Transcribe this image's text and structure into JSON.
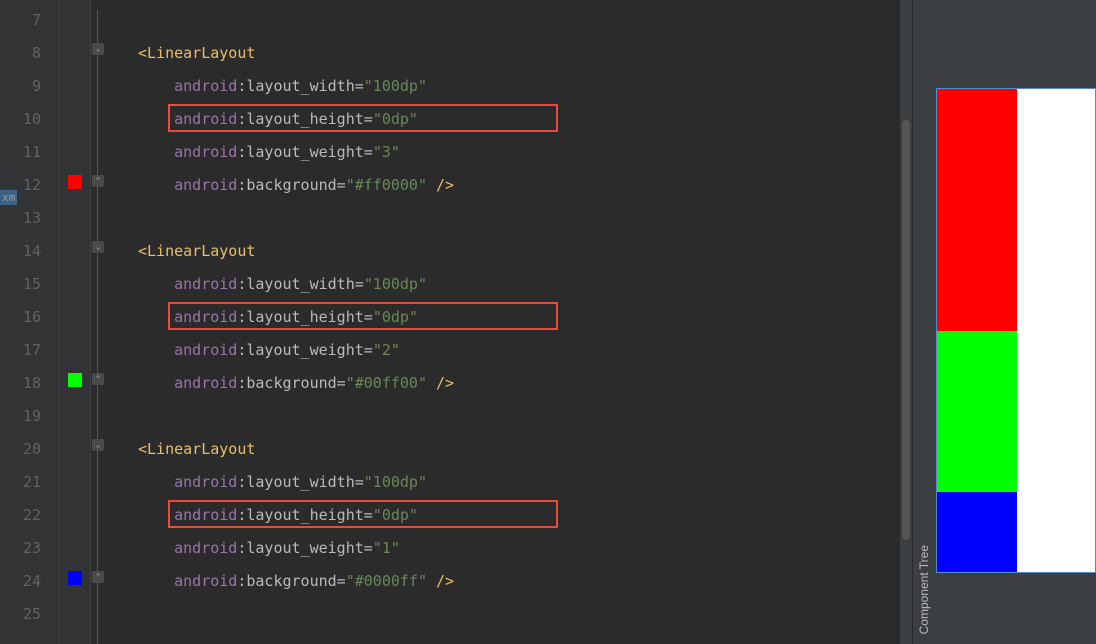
{
  "lineNumbers": [
    "7",
    "8",
    "9",
    "10",
    "11",
    "12",
    "13",
    "14",
    "15",
    "16",
    "17",
    "18",
    "19",
    "20",
    "21",
    "22",
    "23",
    "24",
    "25"
  ],
  "xmTab": "xm",
  "componentTreeLabel": "Component Tree",
  "code": {
    "l8_tag": "LinearLayout",
    "l9_ns": "android",
    "l9_attr": ":layout_width=",
    "l9_val": "\"100dp\"",
    "l10_ns": "android",
    "l10_attr": ":layout_height=",
    "l10_val": "\"0dp\"",
    "l11_ns": "android",
    "l11_attr": ":layout_weight=",
    "l11_val": "\"3\"",
    "l12_ns": "android",
    "l12_attr": ":background=",
    "l12_val": "\"#ff0000\"",
    "l12_close": " />",
    "l14_tag": "LinearLayout",
    "l15_ns": "android",
    "l15_attr": ":layout_width=",
    "l15_val": "\"100dp\"",
    "l16_ns": "android",
    "l16_attr": ":layout_height=",
    "l16_val": "\"0dp\"",
    "l17_ns": "android",
    "l17_attr": ":layout_weight=",
    "l17_val": "\"2\"",
    "l18_ns": "android",
    "l18_attr": ":background=",
    "l18_val": "\"#00ff00\"",
    "l18_close": " />",
    "l20_tag": "LinearLayout",
    "l21_ns": "android",
    "l21_attr": ":layout_width=",
    "l21_val": "\"100dp\"",
    "l22_ns": "android",
    "l22_attr": ":layout_height=",
    "l22_val": "\"0dp\"",
    "l23_ns": "android",
    "l23_attr": ":layout_weight=",
    "l23_val": "\"1\"",
    "l24_ns": "android",
    "l24_attr": ":background=",
    "l24_val": "\"#0000ff\"",
    "l24_close": " />"
  },
  "colorSwatches": {
    "red": "#ff0000",
    "green": "#00ff00",
    "blue": "#0000ff"
  },
  "preview": {
    "blocks": [
      {
        "color": "#ff0000",
        "weight": 3
      },
      {
        "color": "#00ff00",
        "weight": 2
      },
      {
        "color": "#0000ff",
        "weight": 1
      }
    ]
  }
}
